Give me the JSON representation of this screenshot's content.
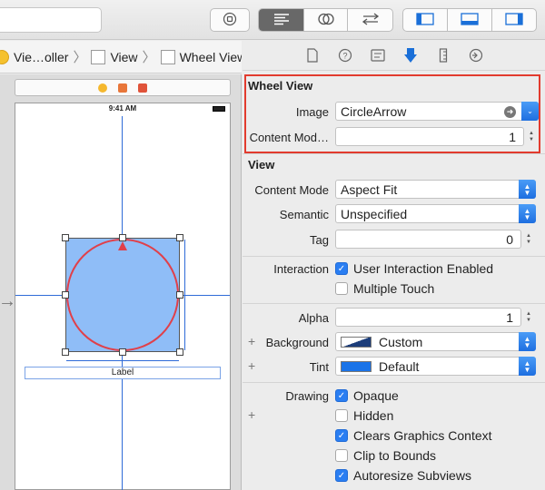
{
  "toolbar": {
    "icons": [
      "stop-circle-icon",
      "standard-editor-icon",
      "assistant-editor-icon",
      "version-editor-icon",
      "navigator-toggle-icon",
      "debug-area-toggle-icon",
      "utilities-toggle-icon"
    ]
  },
  "breadcrumbs": [
    {
      "label": "Vie…oller",
      "icon": "view-controller-icon"
    },
    {
      "label": "View",
      "icon": "view-icon"
    },
    {
      "label": "Wheel View",
      "icon": "view-icon"
    }
  ],
  "canvas": {
    "status_time": "9:41 AM",
    "label_text": "Label",
    "colors": {
      "wheel_fill": "#8fbdf7",
      "circle_stroke": "#e0404a",
      "guide": "#2f6bd8"
    }
  },
  "inspector": {
    "tabs": [
      "file-inspector-icon",
      "quick-help-icon",
      "identity-inspector-icon",
      "attributes-inspector-icon",
      "size-inspector-icon",
      "connections-inspector-icon"
    ],
    "wheel_view": {
      "title": "Wheel View",
      "image_label": "Image",
      "image_value": "CircleArrow",
      "content_mode_label": "Content Mod…",
      "content_mode_value": "1"
    },
    "view": {
      "title": "View",
      "content_mode_label": "Content Mode",
      "content_mode_value": "Aspect Fit",
      "semantic_label": "Semantic",
      "semantic_value": "Unspecified",
      "tag_label": "Tag",
      "tag_value": "0",
      "interaction_label": "Interaction",
      "user_interaction_label": "User Interaction Enabled",
      "user_interaction_checked": true,
      "multiple_touch_label": "Multiple Touch",
      "multiple_touch_checked": false,
      "alpha_label": "Alpha",
      "alpha_value": "1",
      "background_label": "Background",
      "background_value": "Custom",
      "tint_label": "Tint",
      "tint_value": "Default",
      "tint_color": "#1a73e8",
      "drawing_label": "Drawing",
      "opaque_label": "Opaque",
      "opaque_checked": true,
      "hidden_label": "Hidden",
      "hidden_checked": false,
      "clears_label": "Clears Graphics Context",
      "clears_checked": true,
      "clip_label": "Clip to Bounds",
      "clip_checked": false,
      "autoresize_label": "Autoresize Subviews",
      "autoresize_checked": true
    },
    "highlight_color": "#e23b2e"
  }
}
